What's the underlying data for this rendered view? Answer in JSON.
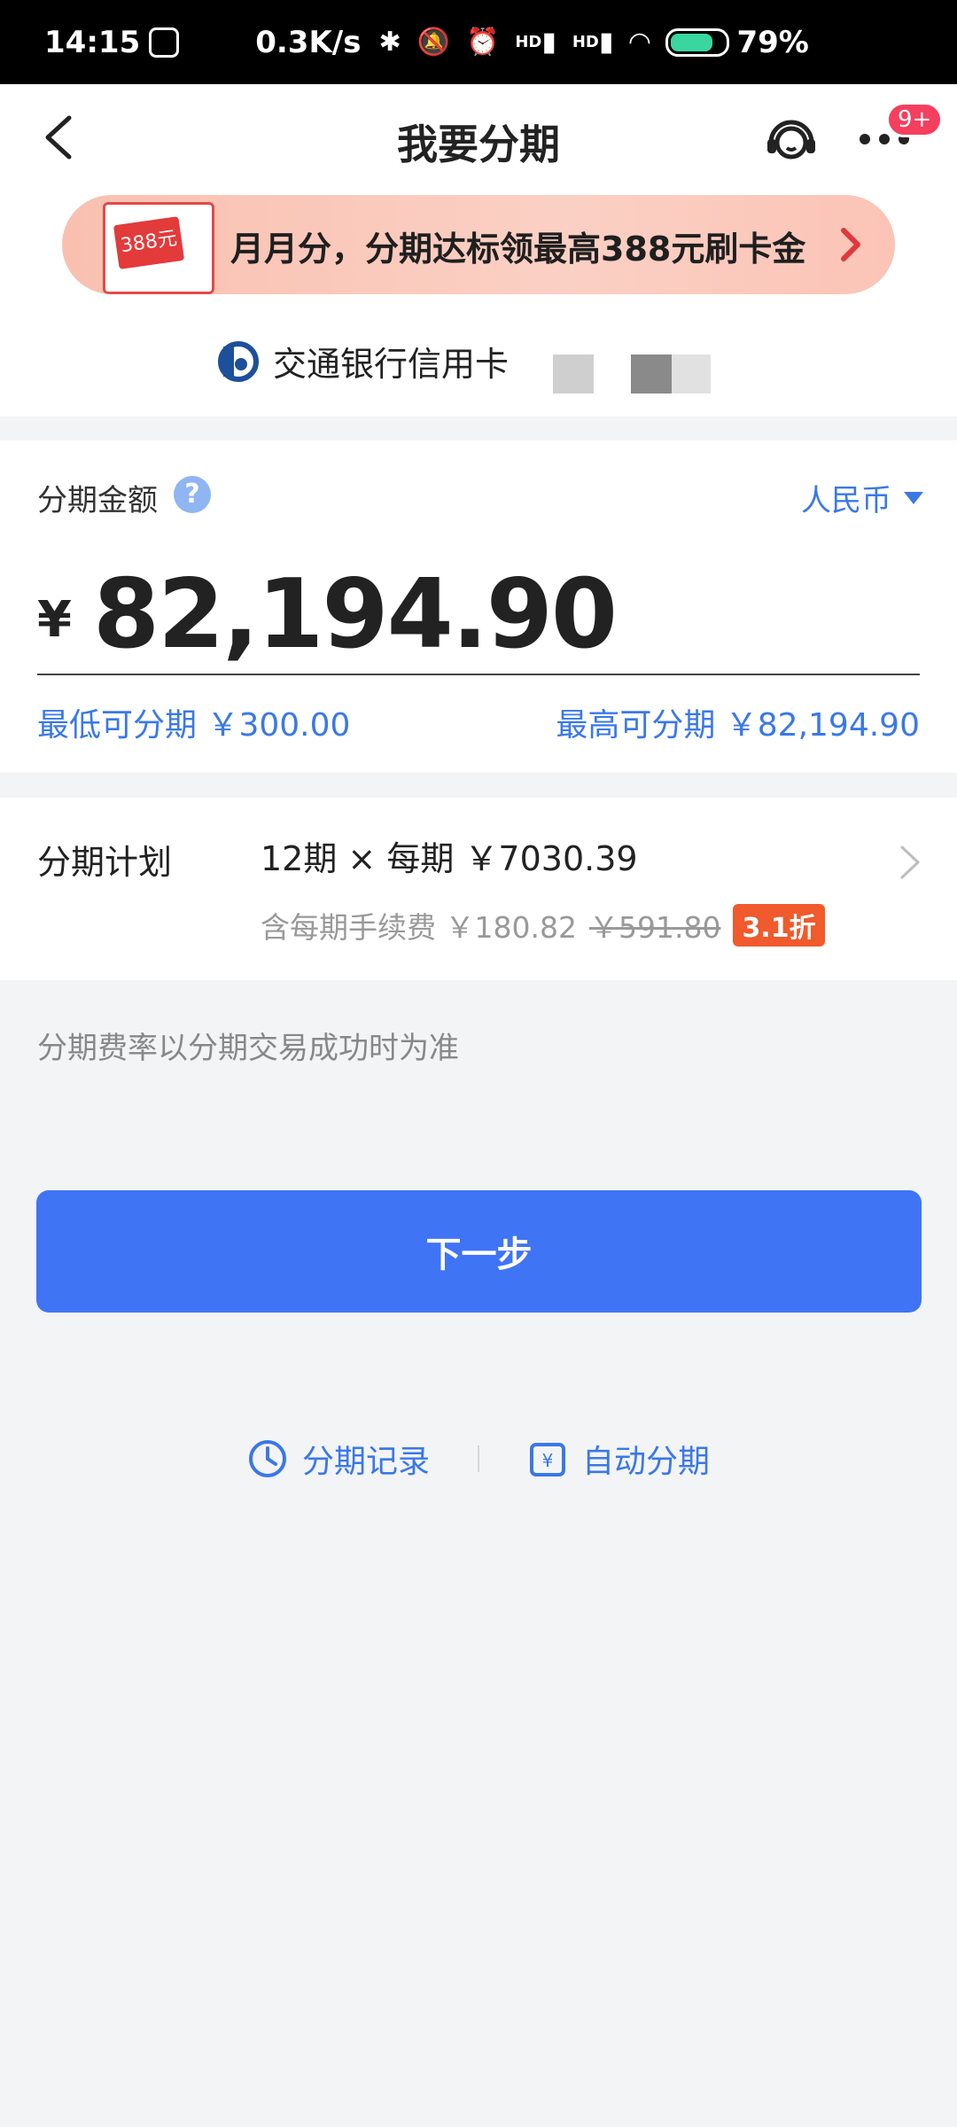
{
  "status_bar": {
    "time": "14:15",
    "net_speed": "0.3K/s",
    "battery": "79%",
    "signal1": "HD",
    "signal2": "HD"
  },
  "header": {
    "title": "我要分期",
    "notification_badge": "9+"
  },
  "banner": {
    "text": "月月分，分期达标领最高388元刷卡金",
    "image_tag": "388元"
  },
  "bank": {
    "name": "交通银行信用卡"
  },
  "amount": {
    "label": "分期金额",
    "help": "?",
    "currency": "人民币",
    "symbol": "¥",
    "value": "82,194.90",
    "min_text": "最低可分期  ￥300.00",
    "max_text": "最高可分期  ￥82,194.90"
  },
  "plan": {
    "label": "分期计划",
    "main": "12期 × 每期  ￥7030.39",
    "fee_text": "含每期手续费  ￥180.82",
    "old_fee": "￥591.80",
    "discount": "3.1折"
  },
  "rate_note": "分期费率以分期交易成功时为准",
  "next_button": "下一步",
  "links": {
    "records": "分期记录",
    "auto": "自动分期"
  },
  "colors": {
    "accent": "#3f74f5",
    "link": "#3a78e8",
    "discount": "#f05a2c"
  }
}
